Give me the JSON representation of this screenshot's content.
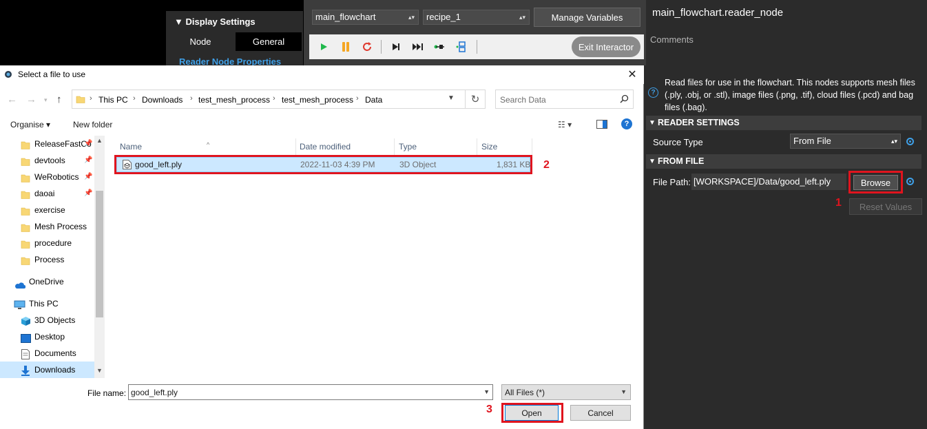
{
  "display_settings": {
    "title": "Display Settings",
    "tab_node": "Node",
    "tab_general": "General",
    "link": "Reader Node Properties"
  },
  "toolbar": {
    "flowchart_select": "main_flowchart",
    "recipe_select": "recipe_1",
    "manage_variables": "Manage Variables",
    "exit_interactor": "Exit Interactor",
    "icons": [
      "play-icon",
      "pause-icon",
      "reload-icon",
      "step-icon",
      "fast-forward-icon",
      "run-to-node-icon",
      "flow-node-icon"
    ]
  },
  "properties": {
    "node_title": "main_flowchart.reader_node",
    "comments_label": "Comments",
    "description": "Read files for use in the flowchart. This nodes supports mesh files (.ply, .obj, or .stl), image files (.png, .tif), cloud files (.pcd) and bag files (.bag).",
    "reader_settings_header": "READER SETTINGS",
    "source_type_label": "Source Type",
    "source_type_value": "From File",
    "from_file_header": "FROM FILE",
    "file_path_label": "File Path:",
    "file_path_value": "[WORKSPACE]/Data/good_left.ply",
    "browse": "Browse",
    "reset_values": "Reset Values"
  },
  "dialog": {
    "title": "Select a file to use",
    "breadcrumb": [
      "This PC",
      "Downloads",
      "test_mesh_process",
      "test_mesh_process",
      "Data"
    ],
    "search_placeholder": "Search Data",
    "organise": "Organise",
    "new_folder": "New folder",
    "nav_items": [
      {
        "label": "ReleaseFastCo",
        "icon": "folder-icon",
        "pinned": true
      },
      {
        "label": "devtools",
        "icon": "folder-icon",
        "pinned": true
      },
      {
        "label": "WeRobotics",
        "icon": "folder-icon",
        "pinned": true
      },
      {
        "label": "daoai",
        "icon": "folder-icon",
        "pinned": true
      },
      {
        "label": "exercise",
        "icon": "folder-icon",
        "pinned": false
      },
      {
        "label": "Mesh Process",
        "icon": "folder-icon",
        "pinned": false
      },
      {
        "label": "procedure",
        "icon": "folder-icon",
        "pinned": false
      },
      {
        "label": "Process",
        "icon": "folder-icon",
        "pinned": false
      },
      {
        "label": "OneDrive",
        "icon": "onedrive-icon",
        "pinned": false
      },
      {
        "label": "This PC",
        "icon": "computer-icon",
        "pinned": false
      },
      {
        "label": "3D Objects",
        "icon": "3d-objects-icon",
        "pinned": false
      },
      {
        "label": "Desktop",
        "icon": "desktop-icon",
        "pinned": false
      },
      {
        "label": "Documents",
        "icon": "documents-icon",
        "pinned": false
      },
      {
        "label": "Downloads",
        "icon": "downloads-icon",
        "pinned": false
      }
    ],
    "columns": [
      "Name",
      "Date modified",
      "Type",
      "Size"
    ],
    "files": [
      {
        "name": "good_left.ply",
        "date_modified": "2022-11-03 4:39 PM",
        "type": "3D Object",
        "size": "1,831 KB"
      }
    ],
    "file_name_label": "File name:",
    "file_name_value": "good_left.ply",
    "file_type_value": "All Files  (*)",
    "open": "Open",
    "cancel": "Cancel"
  },
  "annotations": {
    "step_1": "1",
    "step_2": "2",
    "step_3": "3",
    "color": "#e0141e"
  }
}
